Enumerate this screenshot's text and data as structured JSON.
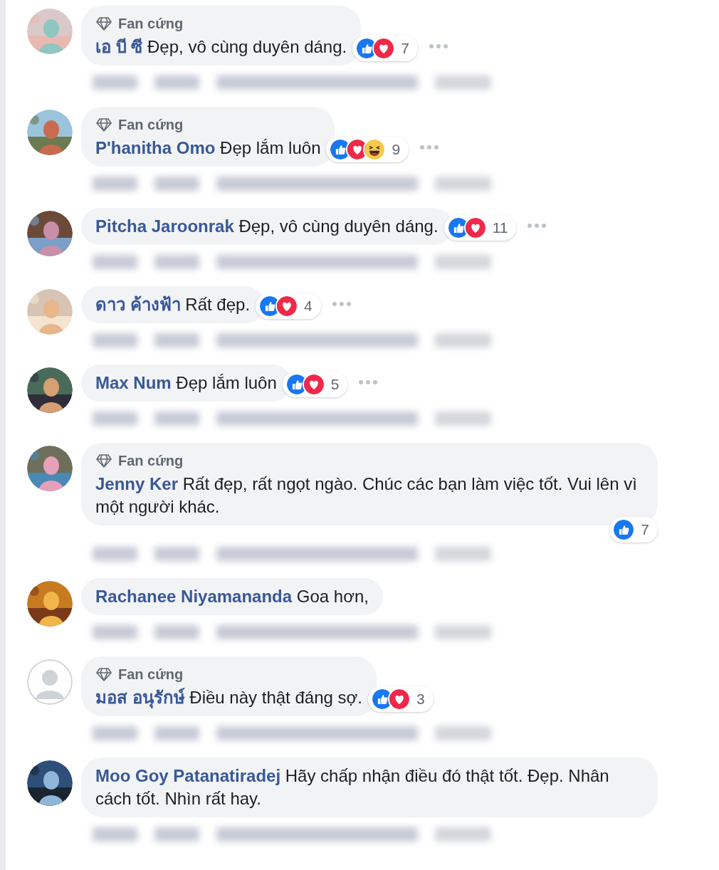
{
  "comments": [
    {
      "badge": "Fan cứng",
      "name": "เอ บี ซี",
      "text": "Đẹp, vô cùng duyên dáng.",
      "reactions": {
        "below_bubble": false,
        "icons": [
          {
            "kind": "like"
          },
          {
            "kind": "love"
          }
        ],
        "count": "7"
      },
      "more_button": true
    },
    {
      "badge": "Fan cứng",
      "name": "P'hanitha Omo",
      "text": "Đẹp lắm luôn",
      "reactions": {
        "below_bubble": false,
        "icons": [
          {
            "kind": "like"
          },
          {
            "kind": "love"
          },
          {
            "kind": "haha"
          }
        ],
        "count": "9"
      },
      "more_button": true
    },
    {
      "name": "Pitcha Jaroonrak",
      "text": "Đẹp, vô cùng duyên dáng.",
      "reactions": {
        "below_bubble": false,
        "icons": [
          {
            "kind": "like"
          },
          {
            "kind": "love"
          }
        ],
        "count": "11"
      },
      "more_button": true
    },
    {
      "name": "ดาว ค้างฟ้า",
      "text": "Rất đẹp.",
      "reactions": {
        "below_bubble": false,
        "icons": [
          {
            "kind": "like"
          },
          {
            "kind": "love"
          }
        ],
        "count": "4"
      },
      "more_button": true
    },
    {
      "name": "Max Num",
      "text": "Đẹp lắm luôn",
      "reactions": {
        "below_bubble": false,
        "icons": [
          {
            "kind": "like"
          },
          {
            "kind": "love"
          }
        ],
        "count": "5"
      },
      "more_button": true
    },
    {
      "badge": "Fan cứng",
      "name": "Jenny Ker",
      "text": "Rất đẹp, rất ngọt ngào. Chúc các bạn làm việc tốt. Vui lên vì một người khác.",
      "reactions": {
        "below_bubble": true,
        "icons": [
          {
            "kind": "like"
          }
        ],
        "count": "7"
      },
      "more_button": false
    },
    {
      "name": "Rachanee Niyamananda",
      "text": "Goa hơn,",
      "more_button": false
    },
    {
      "avatar": {
        "kind": "default"
      },
      "badge": "Fan cứng",
      "name": "มอส อนุรักษ์",
      "text": "Điều này thật đáng sợ.",
      "reactions": {
        "below_bubble": false,
        "icons": [
          {
            "kind": "like"
          },
          {
            "kind": "love"
          }
        ],
        "count": "3"
      },
      "more_button": false
    },
    {
      "name": "Moo Goy Patanatiradej",
      "text": "Hãy chấp nhận điều đó thật tốt. Đẹp. Nhân cách tốt. Nhìn rất hay.",
      "more_button": false
    }
  ]
}
